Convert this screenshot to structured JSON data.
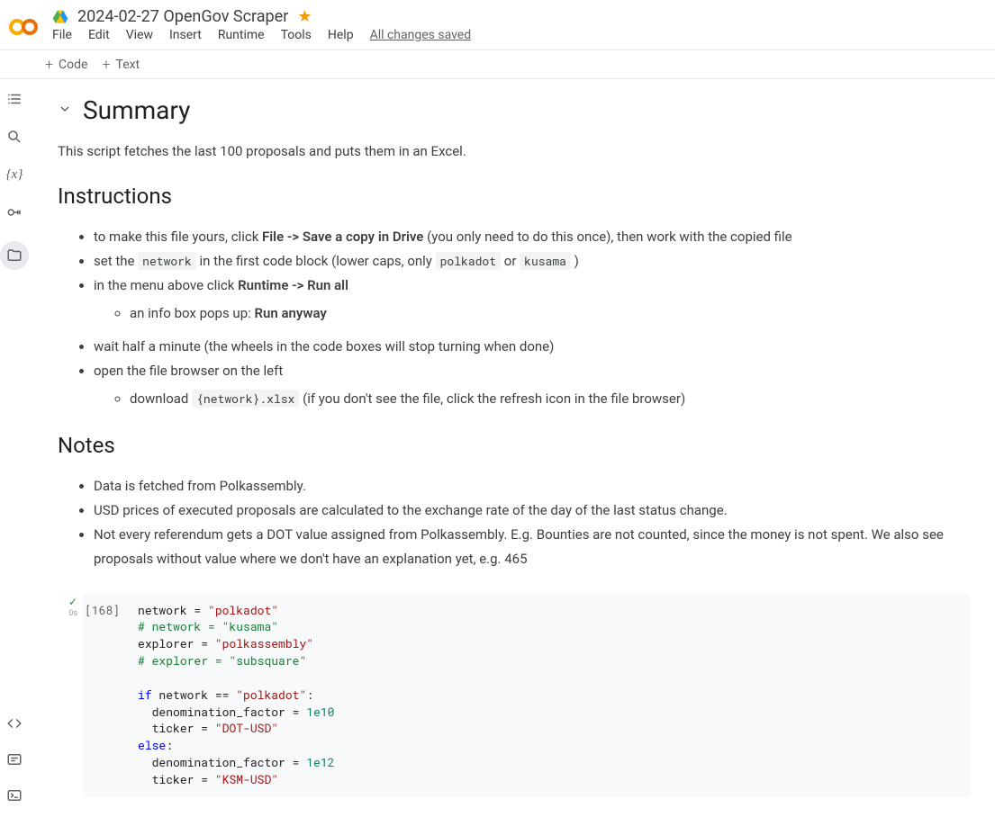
{
  "header": {
    "title": "2024-02-27 OpenGov Scraper",
    "starred": true,
    "menu": [
      "File",
      "Edit",
      "View",
      "Insert",
      "Runtime",
      "Tools",
      "Help"
    ],
    "save_status": "All changes saved"
  },
  "toolbar": {
    "code_label": "Code",
    "text_label": "Text"
  },
  "sidebar_icons": [
    "toc",
    "search",
    "variables",
    "secrets",
    "files"
  ],
  "content": {
    "summary_heading": "Summary",
    "summary_text": "This script fetches the last 100 proposals and puts them in an Excel.",
    "instructions_heading": "Instructions",
    "instructions": {
      "i1_pre": "to make this file yours, click ",
      "i1_bold": "File -> Save a copy in Drive",
      "i1_post": " (you only need to do this once), then work with the copied file",
      "i2_pre": "set the ",
      "i2_code1": "network",
      "i2_mid": " in the first code block (lower caps, only ",
      "i2_code2": "polkadot",
      "i2_or": " or ",
      "i2_code3": "kusama",
      "i2_post": " )",
      "i3_pre": "in the menu above click ",
      "i3_bold": "Runtime -> Run all",
      "i3a_pre": "an info box pops up: ",
      "i3a_bold": "Run anyway",
      "i4": "wait half a minute (the wheels in the code boxes will stop turning when done)",
      "i5": "open the file browser on the left",
      "i5a_pre": "download ",
      "i5a_code": "{network}.xlsx",
      "i5a_post": " (if you don't see the file, click the refresh icon in the file browser)"
    },
    "notes_heading": "Notes",
    "notes": [
      "Data is fetched from Polkassembly.",
      "USD prices of executed proposals are calculated to the exchange rate of the day of the last status change.",
      "Not every referendum gets a DOT value assigned from Polkassembly. E.g. Bounties are not counted, since the money is not spent. We also see proposals without value where we don't have an explanation yet, e.g. 465"
    ]
  },
  "code_cell": {
    "exec_count": "[168]",
    "exec_time": "0s",
    "lines": [
      {
        "t": "assign",
        "var": "network",
        "op": " = ",
        "val": "\"polkadot\"",
        "cls": "s-str"
      },
      {
        "t": "comment",
        "text": "# network = \"kusama\""
      },
      {
        "t": "assign",
        "var": "explorer",
        "op": " = ",
        "val": "\"polkassembly\"",
        "cls": "s-str"
      },
      {
        "t": "comment",
        "text": "# explorer = \"subsquare\""
      },
      {
        "t": "blank"
      },
      {
        "t": "if",
        "kw": "if",
        "cond": " network == ",
        "val": "\"polkadot\"",
        "tail": ":"
      },
      {
        "t": "assign2",
        "var": "  denomination_factor",
        "op": " = ",
        "val": "1e10",
        "cls": "s-num"
      },
      {
        "t": "assign2",
        "var": "  ticker",
        "op": " = ",
        "val": "\"DOT-USD\"",
        "cls": "s-str"
      },
      {
        "t": "else",
        "kw": "else",
        "tail": ":"
      },
      {
        "t": "assign2",
        "var": "  denomination_factor",
        "op": " = ",
        "val": "1e12",
        "cls": "s-num"
      },
      {
        "t": "assign2",
        "var": "  ticker",
        "op": " = ",
        "val": "\"KSM-USD\"",
        "cls": "s-str"
      }
    ]
  }
}
